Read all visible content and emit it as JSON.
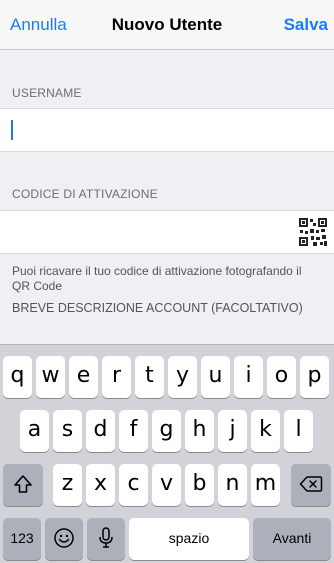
{
  "navbar": {
    "cancel_label": "Annulla",
    "title": "Nuovo Utente",
    "save_label": "Salva"
  },
  "form": {
    "username_header": "USERNAME",
    "username_value": "",
    "activation_header": "CODICE DI ATTIVAZIONE",
    "activation_value": "",
    "qr_hint": "Puoi ricavare il tuo codice di attivazione fotografando il QR Code",
    "description_header": "BREVE DESCRIZIONE ACCOUNT (FACOLTATIVO)"
  },
  "keyboard": {
    "row1": [
      "q",
      "w",
      "e",
      "r",
      "t",
      "y",
      "u",
      "i",
      "o",
      "p"
    ],
    "row2": [
      "a",
      "s",
      "d",
      "f",
      "g",
      "h",
      "j",
      "k",
      "l"
    ],
    "row3": [
      "z",
      "x",
      "c",
      "v",
      "b",
      "n",
      "m"
    ],
    "numbers_label": "123",
    "space_label": "spazio",
    "return_label": "Avanti"
  },
  "colors": {
    "accent": "#1a7cf5"
  },
  "icons": [
    "qr-code-icon",
    "shift-icon",
    "backspace-icon",
    "emoji-icon",
    "microphone-icon"
  ]
}
